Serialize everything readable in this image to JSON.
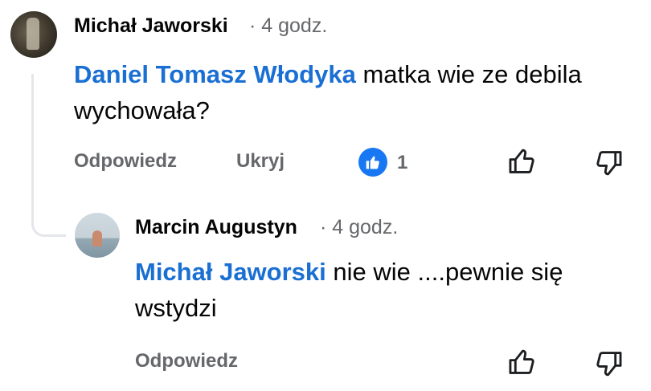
{
  "comment": {
    "author": "Michał Jaworski",
    "time": "· 4 godz.",
    "mention": "Daniel Tomasz Włodyka",
    "text": " matka wie ze debila wychowała?",
    "actions": {
      "reply": "Odpowiedz",
      "hide": "Ukryj"
    },
    "reaction_count": "1"
  },
  "reply": {
    "author": "Marcin Augustyn",
    "time": "· 4 godz.",
    "mention": "Michał Jaworski",
    "text": " nie wie ....pewnie się wstydzi",
    "actions": {
      "reply": "Odpowiedz"
    }
  },
  "icons": {
    "reaction": "like-reaction-icon",
    "up": "thumb-up-outline-icon",
    "down": "thumb-down-outline-icon"
  },
  "colors": {
    "mention": "#1a6fd3",
    "like_badge": "#1877f2",
    "muted": "#65676b"
  }
}
